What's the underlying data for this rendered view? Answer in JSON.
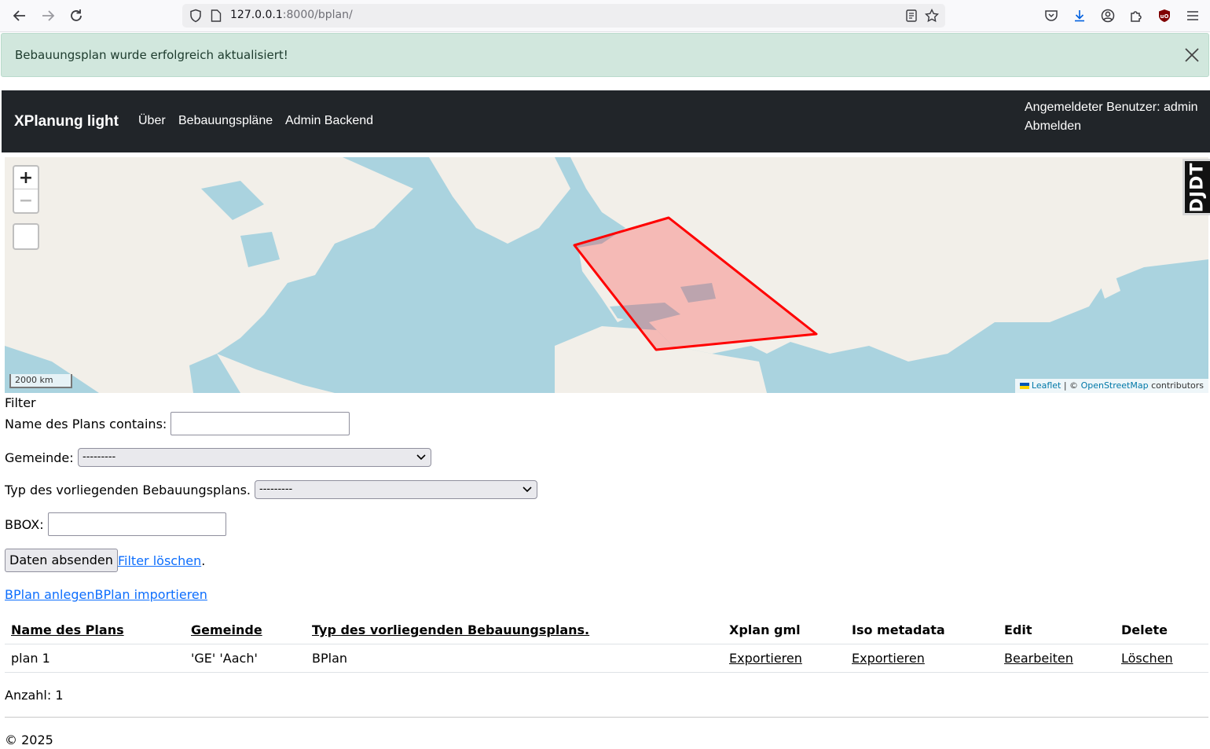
{
  "browser": {
    "url_host": "127.0.0.1",
    "url_rest": ":8000/bplan/"
  },
  "alert": {
    "message": "Bebauungsplan wurde erfolgreich aktualisiert!"
  },
  "navbar": {
    "brand": "XPlanung light",
    "links": [
      "Über",
      "Bebauungspläne",
      "Admin Backend"
    ],
    "user_label": "Angemeldeter Benutzer: admin",
    "logout": "Abmelden"
  },
  "map": {
    "zoom_in": "+",
    "zoom_out": "−",
    "scale": "2000 km",
    "attribution_leaflet": "Leaflet",
    "attribution_sep": "| ©",
    "attribution_osm": "OpenStreetMap",
    "attribution_tail": "contributors",
    "polygon_color": "#ff0000",
    "djdt": "DJDT"
  },
  "filter": {
    "heading": "Filter",
    "name_label": "Name des Plans contains:",
    "name_value": "",
    "gemeinde_label": "Gemeinde:",
    "gemeinde_selected": "---------",
    "typ_label": "Typ des vorliegenden Bebauungsplans.",
    "typ_selected": "---------",
    "bbox_label": "BBOX:",
    "bbox_value": "",
    "submit": "Daten absenden",
    "clear": "Filter löschen",
    "clear_suffix": "."
  },
  "actions": {
    "create": "BPlan anlegen",
    "import": "BPlan importieren"
  },
  "table": {
    "headers": {
      "name": "Name des Plans",
      "gemeinde": "Gemeinde",
      "typ": "Typ des vorliegenden Bebauungsplans.",
      "xplan": "Xplan gml",
      "iso": "Iso metadata",
      "edit": "Edit",
      "delete": "Delete"
    },
    "rows": [
      {
        "name": "plan 1",
        "gemeinde": "'GE' 'Aach'",
        "typ": "BPlan",
        "xplan": "Exportieren",
        "iso": "Exportieren",
        "edit": "Bearbeiten",
        "delete": "Löschen"
      }
    ]
  },
  "count_label": "Anzahl: 1",
  "footer": "© 2025"
}
